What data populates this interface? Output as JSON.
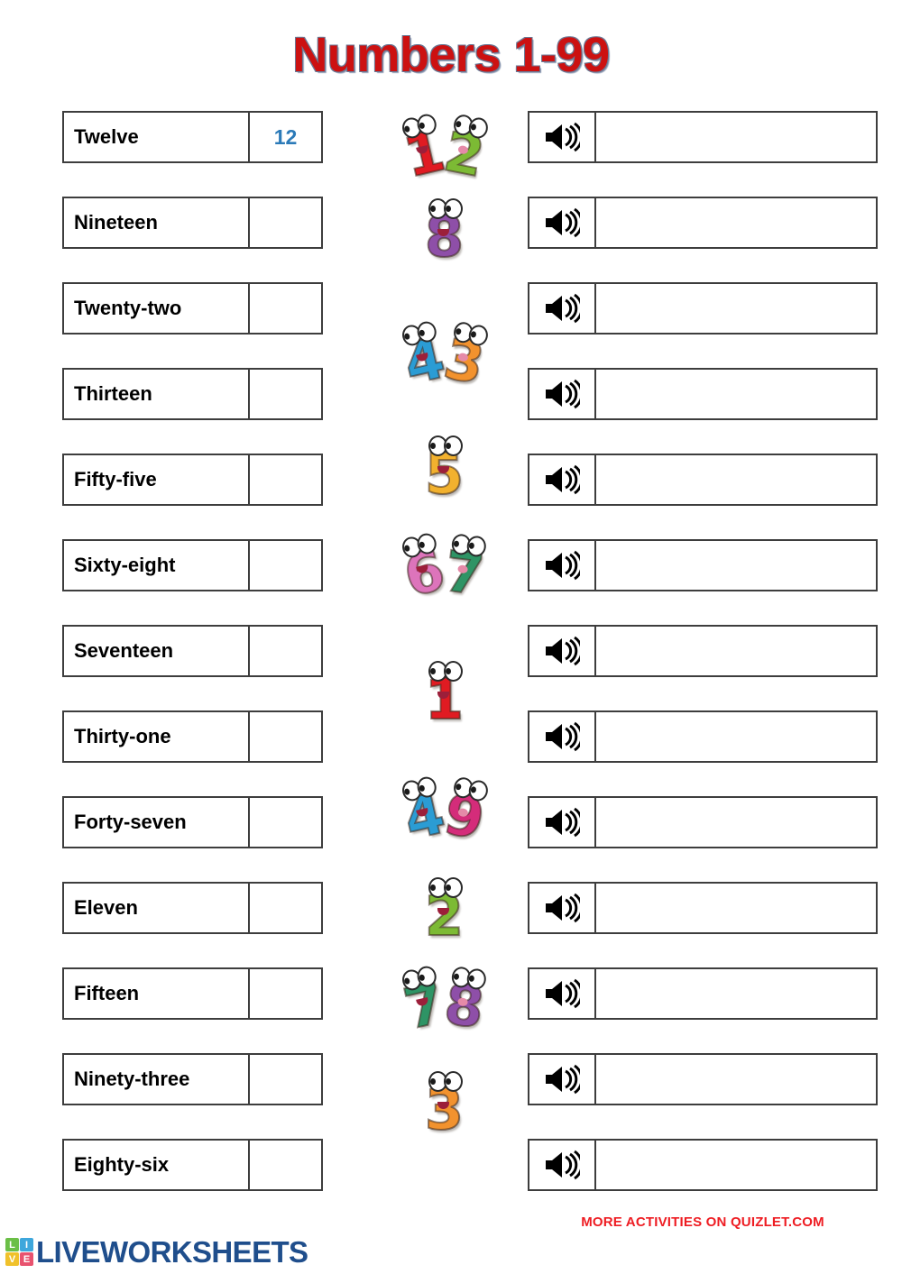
{
  "title": "Numbers 1-99",
  "colors": {
    "title": "#cc1111",
    "answer_text": "#2b7ab8",
    "quizlet_note": "#ee1c22",
    "logo_wordmark": "#1f4e8c"
  },
  "footer": {
    "quizlet_note": "MORE ACTIVITIES ON QUIZLET.COM",
    "logo_wordmark": "LIVEWORKSHEETS",
    "logo_tiles": [
      "L",
      "I",
      "V",
      "E"
    ]
  },
  "speaker_icon": "speaker-icon",
  "answer_placeholder": "",
  "rows": [
    {
      "word": "Twelve",
      "answer": "12",
      "clipart": {
        "label": "12",
        "digits": [
          {
            "char": "1",
            "color": "#e01b22",
            "tilt": "tilt-l"
          },
          {
            "char": "2",
            "color": "#7cba34",
            "tilt": "tilt-r"
          }
        ]
      }
    },
    {
      "word": "Nineteen",
      "answer": "",
      "clipart": {
        "label": "8",
        "digits": [
          {
            "char": "8",
            "color": "#8e4fa8",
            "tilt": "none"
          }
        ]
      }
    },
    {
      "word": "Twenty-two",
      "answer": "",
      "clipart": {
        "label": "43",
        "digits": [
          {
            "char": "4",
            "color": "#2b9cd4",
            "tilt": "tilt-l"
          },
          {
            "char": "3",
            "color": "#f2922e",
            "tilt": "tilt-r"
          }
        ]
      }
    },
    {
      "word": "Thirteen",
      "answer": "",
      "clipart": {
        "label": "5",
        "digits": [
          {
            "char": "5",
            "color": "#f2b12e",
            "tilt": "none"
          }
        ]
      }
    },
    {
      "word": "Fifty-five",
      "answer": "",
      "clipart": {
        "label": "67",
        "digits": [
          {
            "char": "6",
            "color": "#dd74bb",
            "tilt": "tilt-l"
          },
          {
            "char": "7",
            "color": "#2e9465",
            "tilt": "tilt-r2"
          }
        ]
      }
    },
    {
      "word": "Sixty-eight",
      "answer": "",
      "clipart": {
        "label": "1",
        "digits": [
          {
            "char": "1",
            "color": "#e01b22",
            "tilt": "none"
          }
        ]
      }
    },
    {
      "word": "Seventeen",
      "answer": "",
      "clipart": {
        "label": "49",
        "digits": [
          {
            "char": "4",
            "color": "#2b9cd4",
            "tilt": "tilt-l"
          },
          {
            "char": "9",
            "color": "#d42c7a",
            "tilt": "tilt-r"
          }
        ]
      }
    },
    {
      "word": "Thirty-one",
      "answer": "",
      "clipart": {
        "label": "2",
        "digits": [
          {
            "char": "2",
            "color": "#7cba34",
            "tilt": "none"
          }
        ]
      }
    },
    {
      "word": "Forty-seven",
      "answer": "",
      "clipart": {
        "label": "78",
        "digits": [
          {
            "char": "7",
            "color": "#2e9465",
            "tilt": "tilt-l"
          },
          {
            "char": "8",
            "color": "#8e4fa8",
            "tilt": "tilt-r2"
          }
        ]
      }
    },
    {
      "word": "Eleven",
      "answer": "",
      "clipart": {
        "label": "3",
        "digits": [
          {
            "char": "3",
            "color": "#f2922e",
            "tilt": "none"
          }
        ]
      }
    },
    {
      "word": "Fifteen",
      "answer": "",
      "clipart": null
    },
    {
      "word": "Ninety-three",
      "answer": "",
      "clipart": null
    },
    {
      "word": "Eighty-six",
      "answer": "",
      "clipart": null
    }
  ],
  "layout": {
    "row_tops": [
      123,
      218,
      313,
      408,
      503,
      598,
      693,
      788,
      883,
      978,
      1073,
      1168,
      1263
    ],
    "clipart_tops": [
      140,
      232,
      370,
      495,
      605,
      745,
      875,
      985,
      1085,
      1200
    ]
  }
}
